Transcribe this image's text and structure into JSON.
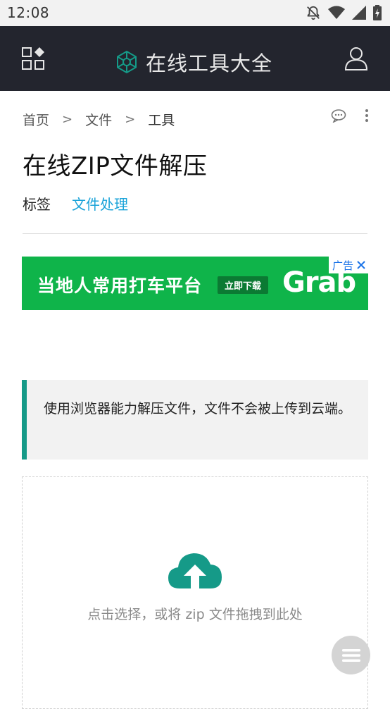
{
  "status_bar": {
    "time": "12:08",
    "icons": [
      "notifications-off-icon",
      "wifi-icon",
      "signal-icon",
      "battery-charging-icon"
    ]
  },
  "header": {
    "brand_title": "在线工具大全",
    "brand_icon": "hexagon-network-icon",
    "left_icon": "apps-grid-icon",
    "right_icon": "user-icon",
    "background": "#23252e"
  },
  "breadcrumb": {
    "items": [
      "首页",
      "文件",
      "工具"
    ],
    "separator": ">"
  },
  "page": {
    "title": "在线ZIP文件解压",
    "tags_label": "标签",
    "tags": [
      "文件处理"
    ]
  },
  "ad": {
    "slogan": "当地人常用打车平台",
    "cta": "立即下载",
    "logo_text": "Grab",
    "ad_label": "广告",
    "background": "#0fb44a"
  },
  "notice": {
    "text": "使用浏览器能力解压文件，文件不会被上传到云端。",
    "accent": "#159a88"
  },
  "dropzone": {
    "hint": "点击选择，或将 zip 文件拖拽到此处",
    "icon": "cloud-upload-icon",
    "icon_color": "#159a88"
  },
  "fab": {
    "icon": "menu-icon"
  }
}
